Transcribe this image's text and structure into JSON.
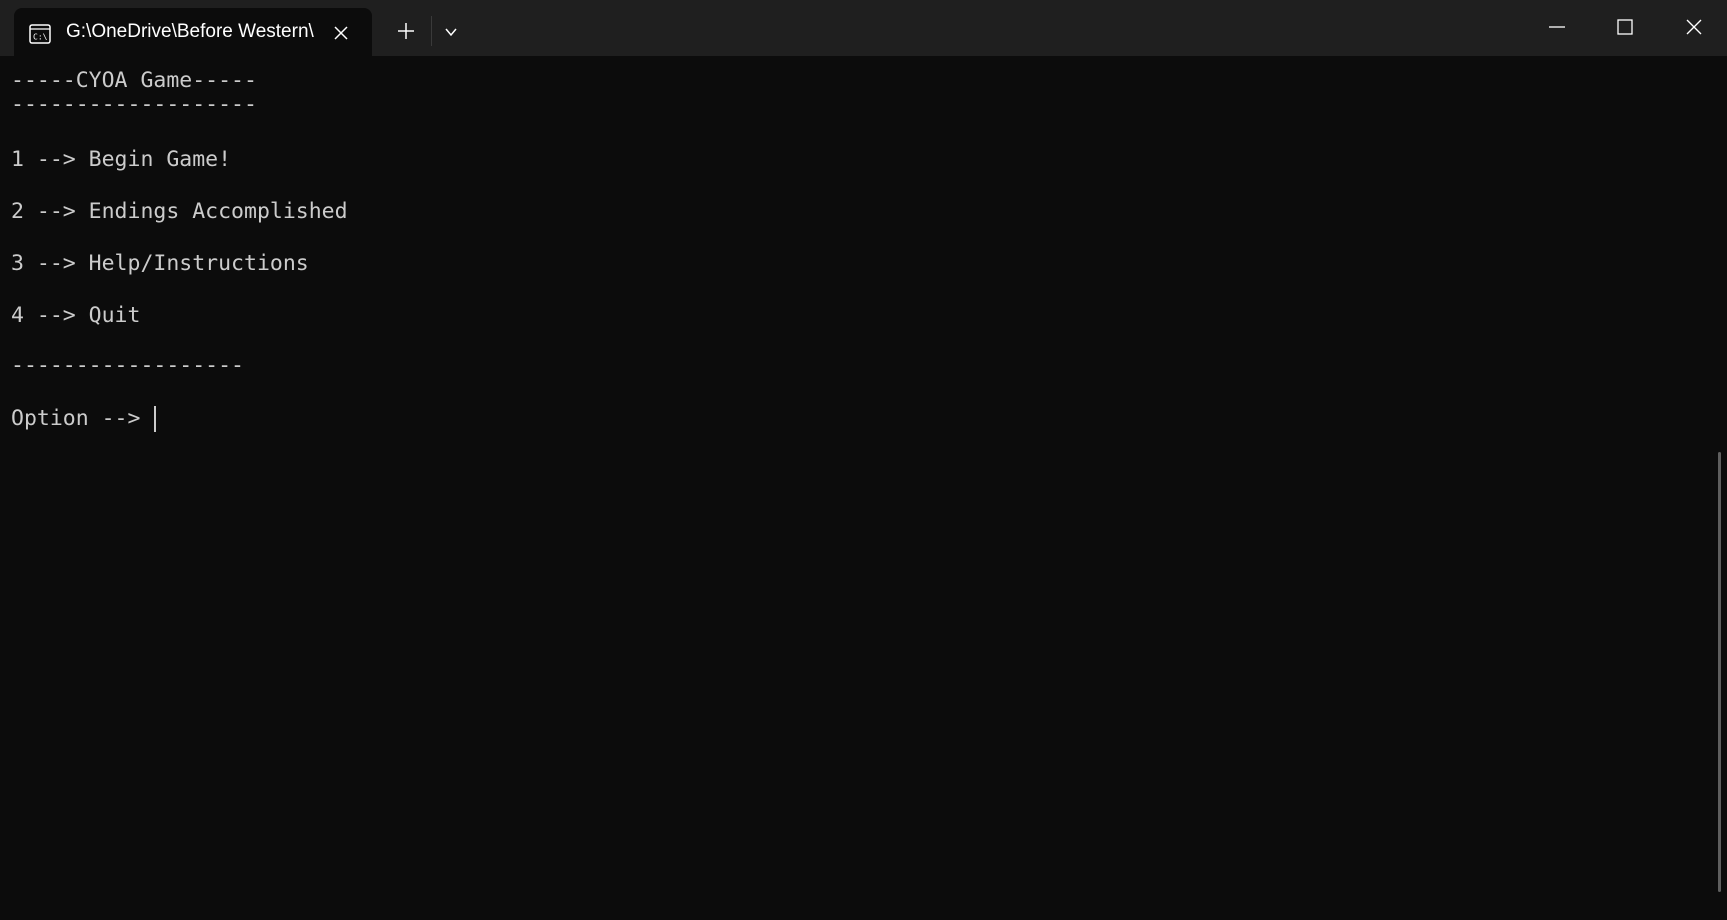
{
  "tab": {
    "title": "G:\\OneDrive\\Before Western\\",
    "icon": "terminal-icon"
  },
  "titlebar_buttons": {
    "new_tab_icon": "plus-icon",
    "dropdown_icon": "chevron-down-icon",
    "minimize_icon": "minimize-icon",
    "maximize_icon": "maximize-icon",
    "close_icon": "close-icon"
  },
  "console": {
    "header": "-----CYOA Game-----",
    "header_rule": "-------------------",
    "menu": [
      "1 --> Begin Game!",
      "2 --> Endings Accomplished",
      "3 --> Help/Instructions",
      "4 --> Quit"
    ],
    "footer_rule": "------------------",
    "prompt": "Option --> "
  },
  "colors": {
    "background": "#0c0c0c",
    "titlebar": "#1f1f1f",
    "text": "#cccccc"
  }
}
